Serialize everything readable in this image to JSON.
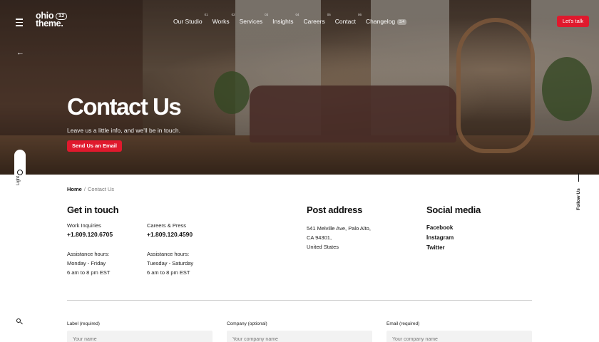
{
  "header": {
    "logo_line1": "ohio",
    "logo_line2": "theme.",
    "logo_version": "3.2",
    "nav": [
      {
        "label": "Our Studio",
        "num": "01"
      },
      {
        "label": "Works",
        "num": "02"
      },
      {
        "label": "Services",
        "num": "03"
      },
      {
        "label": "Insights",
        "num": "04"
      },
      {
        "label": "Careers",
        "num": "05"
      },
      {
        "label": "Contact",
        "num": "06"
      },
      {
        "label": "Changelog",
        "badge": "3.4"
      }
    ],
    "cta_label": "Let's talk"
  },
  "hero": {
    "title": "Contact Us",
    "subtitle": "Leave us a little info, and we'll be in touch.",
    "button_label": "Send Us an Email"
  },
  "side": {
    "light_label": "Light",
    "follow_label": "Follow Us"
  },
  "breadcrumb": {
    "home": "Home",
    "separator": "/",
    "current": "Contact Us"
  },
  "get_in_touch": {
    "title": "Get in touch",
    "col1": {
      "label": "Work Inquiries",
      "phone": "+1.809.120.6705",
      "hours_label": "Assistance hours:",
      "days": "Monday - Friday",
      "time": "6 am to 8 pm EST"
    },
    "col2": {
      "label": "Careers & Press",
      "phone": "+1.809.120.4590",
      "hours_label": "Assistance hours:",
      "days": "Tuesday - Saturday",
      "time": "6 am to 8 pm EST"
    }
  },
  "post_address": {
    "title": "Post address",
    "line1": "541 Melville Ave, Palo Alto,",
    "line2": "CA 94301,",
    "line3": "United States"
  },
  "social": {
    "title": "Social media",
    "links": [
      "Facebook",
      "Instagram",
      "Twitter"
    ]
  },
  "form": {
    "name_label": "Label (required)",
    "name_placeholder": "Your name",
    "company_label": "Company (optional)",
    "company_placeholder": "Your company name",
    "email_label": "Email (required)",
    "email_placeholder": "Your company name"
  },
  "colors": {
    "accent": "#e0192d"
  }
}
